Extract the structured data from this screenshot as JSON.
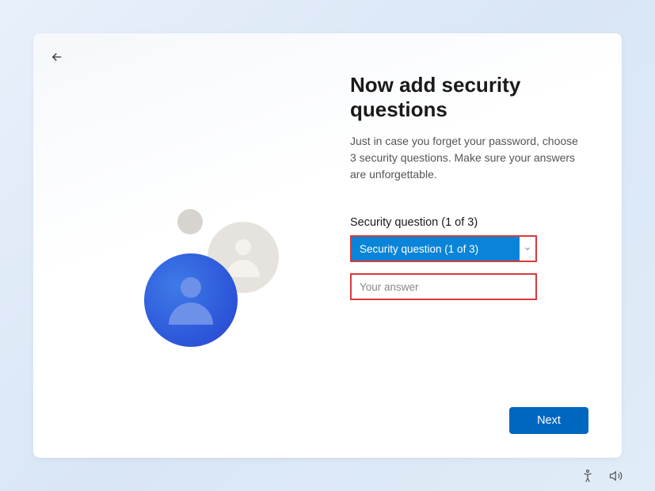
{
  "page": {
    "title": "Now add security questions",
    "subtitle": "Just in case you forget your password, choose 3 security questions. Make sure your answers are unforgettable."
  },
  "form": {
    "question_label": "Security question (1 of 3)",
    "question_dropdown_value": "Security question (1 of 3)",
    "answer_placeholder": "Your answer",
    "answer_value": ""
  },
  "buttons": {
    "next": "Next"
  },
  "icons": {
    "back": "back-arrow",
    "accessibility": "accessibility",
    "volume": "volume"
  }
}
